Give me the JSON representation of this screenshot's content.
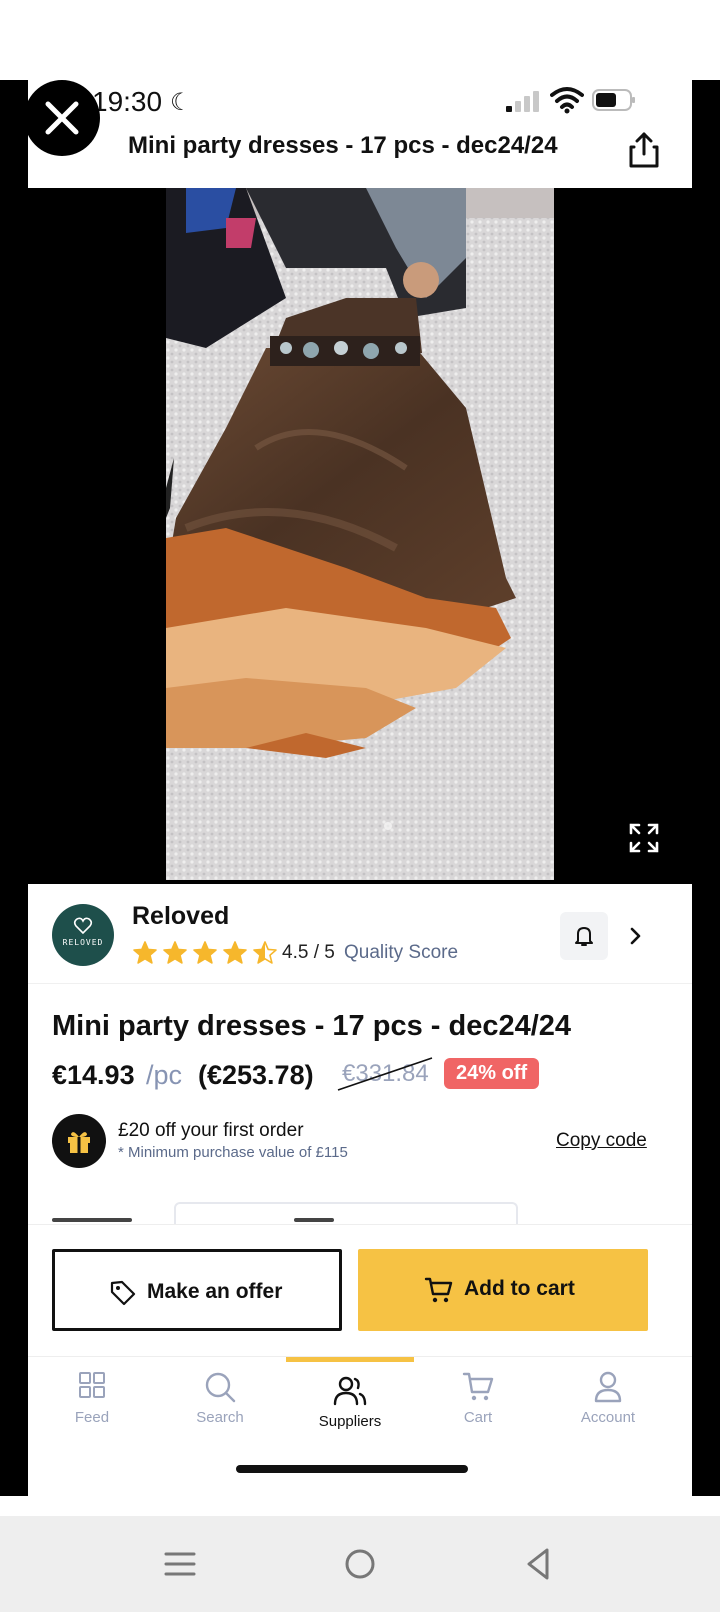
{
  "status_bar": {
    "time": "19:30",
    "moon": "☾"
  },
  "header": {
    "title": "Mini party dresses - 17 pcs - dec24/24"
  },
  "seller": {
    "name": "Reloved",
    "logo_text": "RELOVED",
    "rating": 4.5,
    "rating_text": "4.5 / 5",
    "quality_label": "Quality Score"
  },
  "product": {
    "title": "Mini party dresses - 17 pcs - dec24/24",
    "unit_price": "€14.93",
    "unit_suffix": "/pc",
    "total_price": "(€253.78)",
    "old_price": "€331.84",
    "discount_badge": "24% off"
  },
  "promo": {
    "title": "£20 off your first order",
    "subtitle": "* Minimum purchase value of £115",
    "copy_label": "Copy code"
  },
  "actions": {
    "offer_label": "Make an offer",
    "cart_label": "Add to cart"
  },
  "tabs": [
    {
      "label": "Feed",
      "icon": "grid-icon",
      "active": false
    },
    {
      "label": "Search",
      "icon": "search-icon",
      "active": false
    },
    {
      "label": "Suppliers",
      "icon": "users-icon",
      "active": true
    },
    {
      "label": "Cart",
      "icon": "cart-icon",
      "active": false
    },
    {
      "label": "Account",
      "icon": "user-icon",
      "active": false
    }
  ],
  "colors": {
    "accent": "#f6c244",
    "badge": "#f06565",
    "logo_bg": "#1e4f4b",
    "muted": "#9aa3bb",
    "star": "#f6b72c"
  }
}
